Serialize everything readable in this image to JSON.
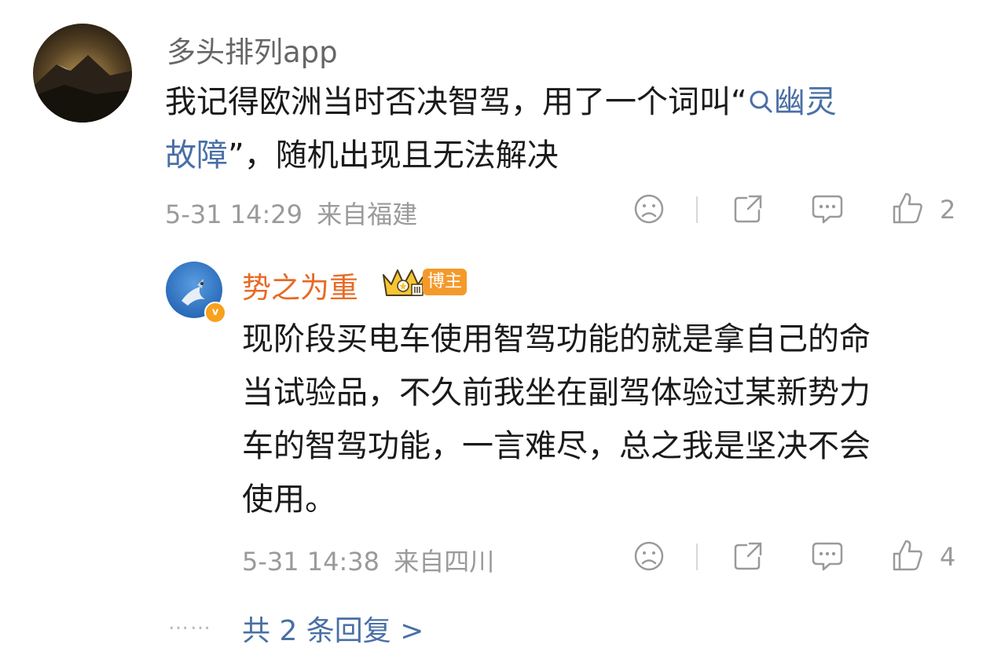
{
  "comment": {
    "username": "多头排列app",
    "text_before": "我记得欧洲当时否决智驾，用了一个词叫",
    "quote_open": "“",
    "topic_line1": "幽灵",
    "topic_line2": "故障",
    "text_after": "”，随机出现且无法解决",
    "time": "5-31 14:29",
    "location": "来自福建",
    "like_count": "2"
  },
  "reply": {
    "username": "势之为重",
    "badge": "博主",
    "verified_mark": "v",
    "line1": "现阶段买电车使用智驾功能的就是拿自己的命",
    "line2": "当试验品，不久前我坐在副驾体验过某新势力",
    "line3": "车的智驾功能，一言难尽，总之我是坚决不会",
    "line4": "使用。",
    "time": "5-31 14:38",
    "location": "来自四川",
    "like_count": "4"
  },
  "more_replies": {
    "dots": "……",
    "label": "共 2 条回复 >"
  },
  "icons": [
    "sad-face-icon",
    "share-icon",
    "comment-icon",
    "like-icon",
    "search-icon",
    "crown-icon",
    "verified-icon"
  ],
  "colors": {
    "link": "#4a6fa5",
    "blogger_name": "#e86a25",
    "badge": "#f39a2b",
    "meta": "#9a9a9a"
  }
}
